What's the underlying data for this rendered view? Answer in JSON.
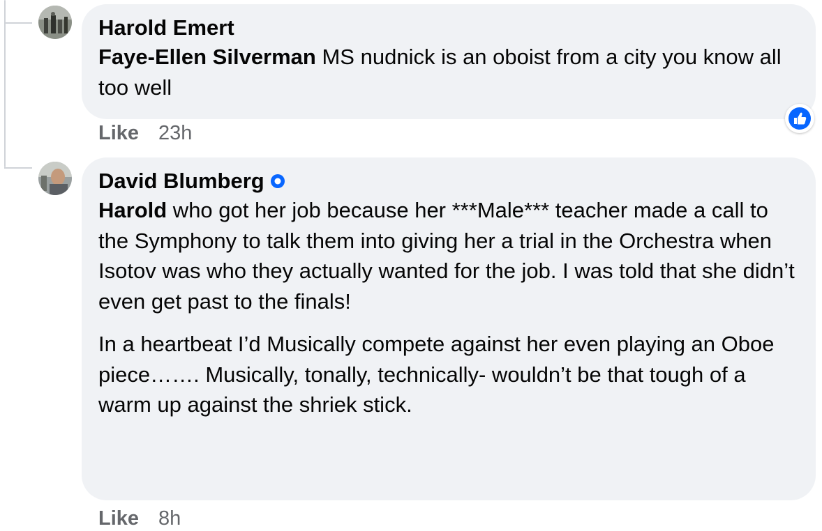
{
  "comments": [
    {
      "author": "Harold Emert",
      "verified": false,
      "mention": "Faye-Ellen Silverman",
      "text": " MS nudnick is an oboist from a city you know all too well",
      "like_label": "Like",
      "timestamp": "23h",
      "reaction": "like-reaction-icon"
    },
    {
      "author": "David Blumberg",
      "verified": true,
      "mention": "Harold",
      "text": " who got her job because her ***Male*** teacher made a call to the Symphony to talk them into giving her a trial in the Orchestra when Isotov was who they actually wanted for the job. I was told that she didn’t even get past to the finals!",
      "text2": "In a heartbeat I’d Musically compete against her even playing an Oboe piece……. Musically, tonally, technically- wouldn’t be that tough of a warm up against the shriek stick.",
      "like_label": "Like",
      "timestamp": "8h"
    }
  ],
  "colors": {
    "bubble": "#f0f2f5",
    "text": "#050505",
    "meta": "#65676b",
    "accent": "#0866ff"
  }
}
